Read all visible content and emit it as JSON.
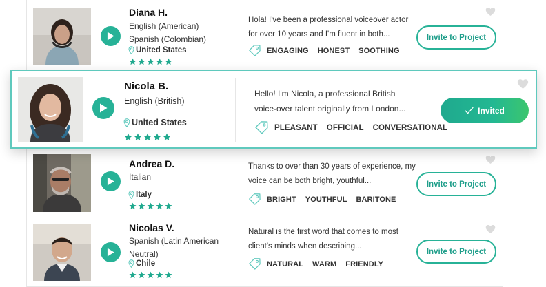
{
  "colors": {
    "accent": "#27b297",
    "featured_border": "#5fc9bd",
    "star": "#1fa98e",
    "heart": "#dcdcdc",
    "text": "#333333"
  },
  "cards": [
    {
      "name": "Diana H.",
      "languages": [
        "English (American)",
        "Spanish (Colombian)"
      ],
      "location": "United States",
      "rating": 5,
      "description": [
        "Hola! I've been a professional voiceover actor",
        "for over 10 years and I'm fluent in both..."
      ],
      "tags": [
        "ENGAGING",
        "HONEST",
        "SOOTHING"
      ],
      "action_label": "Invite to Project",
      "favorited": false
    },
    {
      "name": "Nicola B.",
      "languages": [
        "English (British)"
      ],
      "location": "United States",
      "rating": 5,
      "description": [
        "Hello! I'm Nicola, a professional British",
        "voice-over talent originally from London..."
      ],
      "tags": [
        "PLEASANT",
        "OFFICIAL",
        "CONVERSATIONAL"
      ],
      "action_label": "Invited",
      "favorited": false
    },
    {
      "name": "Andrea D.",
      "languages": [
        "Italian"
      ],
      "location": "Italy",
      "rating": 5,
      "description": [
        "Thanks to over than 30 years of experience, my",
        "voice can be both bright, youthful..."
      ],
      "tags": [
        "BRIGHT",
        "YOUTHFUL",
        "BARITONE"
      ],
      "action_label": "Invite to Project",
      "favorited": false
    },
    {
      "name": "Nicolas V.",
      "languages": [
        "Spanish (Latin American",
        "Neutral)"
      ],
      "location": "Chile",
      "rating": 5,
      "description": [
        "Natural is the first word that comes to most",
        "client's minds when describing..."
      ],
      "tags": [
        "NATURAL",
        "WARM",
        "FRIENDLY"
      ],
      "action_label": "Invite to Project",
      "favorited": false
    }
  ],
  "icons": {
    "play": "play-icon",
    "location": "map-pin-icon",
    "star": "star-icon",
    "tag": "tag-icon",
    "heart": "heart-icon",
    "check": "check-icon"
  }
}
